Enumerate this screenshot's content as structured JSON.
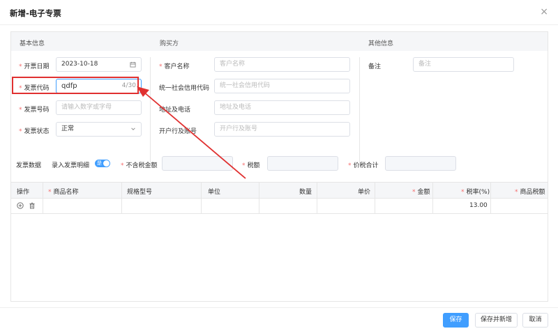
{
  "dialog": {
    "title": "新增-电子专票",
    "close_icon": "×"
  },
  "sections": {
    "basic": "基本信息",
    "buyer": "购买方",
    "other": "其他信息"
  },
  "basic": {
    "date_label": "开票日期",
    "date_value": "2023-10-18",
    "code_label": "发票代码",
    "code_value": "qdfp",
    "code_counter": "4/30",
    "number_label": "发票号码",
    "number_placeholder": "请输入数字或字母",
    "status_label": "发票状态",
    "status_value": "正常"
  },
  "buyer": {
    "name_label": "客户名称",
    "name_placeholder": "客户名称",
    "credit_label": "统一社会信用代码",
    "credit_placeholder": "统一社会信用代码",
    "address_label": "地址及电话",
    "address_placeholder": "地址及电话",
    "bank_label": "开户行及账号",
    "bank_placeholder": "开户行及账号"
  },
  "other": {
    "remark_label": "备注",
    "remark_placeholder": "备注"
  },
  "invoice_data": {
    "label": "发票数据",
    "detail_label": "录入发票明细",
    "toggle_text": "是",
    "untaxed_label": "不含税金额",
    "tax_label": "税额",
    "total_label": "价税合计"
  },
  "table": {
    "headers": [
      "操作",
      "商品名称",
      "规格型号",
      "单位",
      "数量",
      "单价",
      "金额",
      "税率(%)",
      "商品税额"
    ],
    "rows": [
      {
        "tax_rate": "13.00"
      }
    ]
  },
  "footer": {
    "save": "保存",
    "save_new": "保存并新增",
    "cancel": "取消"
  },
  "colors": {
    "accent": "#409eff",
    "required": "#f56c6c",
    "annotation": "#e03030"
  }
}
